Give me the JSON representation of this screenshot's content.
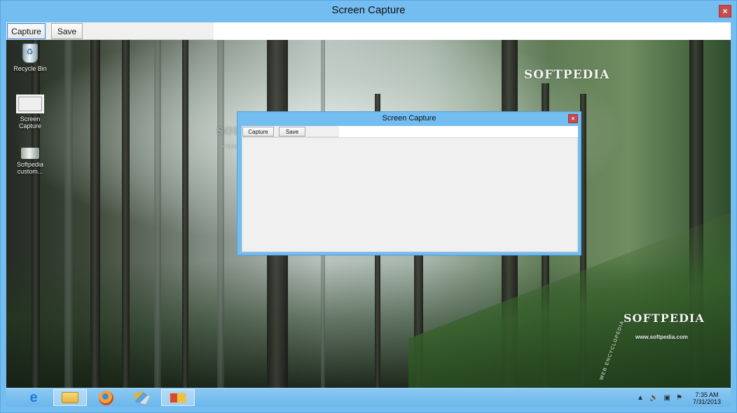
{
  "window": {
    "title": "Screen Capture",
    "close_label": "×"
  },
  "toolbar": {
    "capture_label": "Capture",
    "save_label": "Save"
  },
  "desktop": {
    "icons": [
      {
        "label": "Recycle Bin",
        "icon": "recycle-bin-icon"
      },
      {
        "label": "Screen\nCapture",
        "icon": "screen-capture-icon"
      },
      {
        "label": "Softpedia\ncustom...",
        "icon": "softpedia-icon"
      }
    ],
    "watermarks": {
      "top": "SOFTPEDIA",
      "bottom": "SOFTPEDIA",
      "url": "www.softpedia.com",
      "side": "WEB ENCYCLOPEDIA",
      "ghost_logo": "SOFTPEDIA",
      "ghost_url": "www.softpedia.com"
    }
  },
  "inner_window": {
    "title": "Screen Capture",
    "close_label": "×",
    "capture_label": "Capture",
    "save_label": "Save"
  },
  "taskbar": {
    "apps": [
      {
        "name": "internet-explorer-icon",
        "label": "e"
      },
      {
        "name": "file-explorer-icon",
        "label": ""
      },
      {
        "name": "firefox-icon",
        "label": ""
      },
      {
        "name": "tools-icon",
        "label": ""
      },
      {
        "name": "screen-capture-task-icon",
        "label": ""
      }
    ],
    "tray": {
      "chevron": "▲",
      "volume": "🔊",
      "network": "▣",
      "flag": "⚑",
      "time": "7:35 AM",
      "date": "7/31/2013"
    }
  }
}
